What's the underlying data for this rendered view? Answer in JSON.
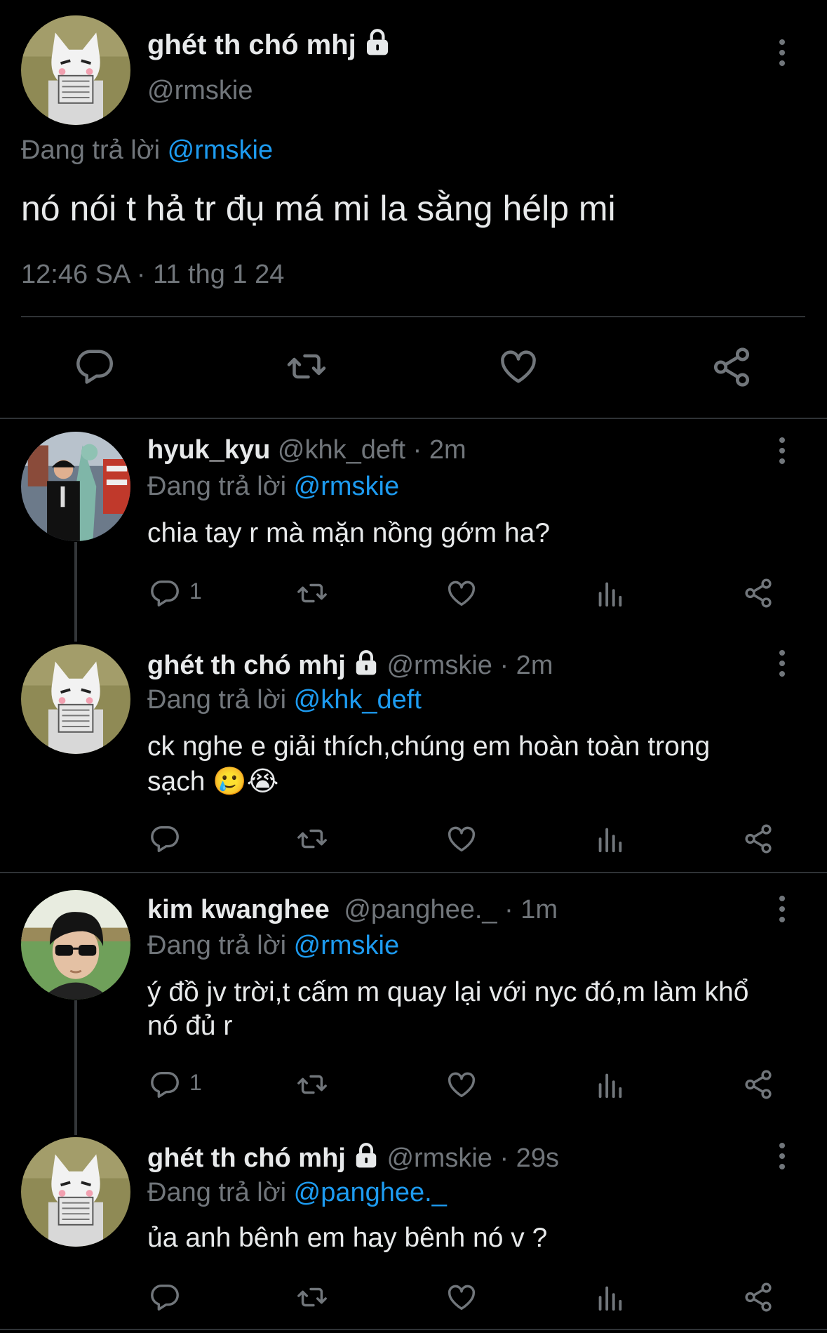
{
  "main_tweet": {
    "display_name": "ghét th chó mhj",
    "handle": "@rmskie",
    "replying_prefix": "Đang trả lời",
    "replying_to": "@rmskie",
    "text": "nó nói t hả tr đụ má mi la sằng hélp mi",
    "timestamp": "12:46 SA · 11 thg 1 24"
  },
  "replies": [
    {
      "display_name": "hyuk_kyu",
      "handle": "@khk_deft",
      "time": "· 2m",
      "replying_prefix": "Đang trả lời",
      "replying_to": "@rmskie",
      "text": "chia tay r mà mặn nồng gớm ha?",
      "reply_count": "1"
    },
    {
      "display_name": "ghét th chó mhj",
      "handle": "@rmskie",
      "time": "· 2m",
      "replying_prefix": "Đang trả lời",
      "replying_to": "@khk_deft",
      "text_line1": "ck nghe e giải thích,chúng em hoàn toàn trong",
      "text_line2": "sạch 🥲😭",
      "reply_count": ""
    },
    {
      "display_name": "kim kwanghee",
      "handle": "@panghee._",
      "time": "· 1m",
      "replying_prefix": "Đang trả lời",
      "replying_to": "@rmskie",
      "text_line1": "ý đồ jv trời,t cấm m quay lại với nyc đó,m làm khổ",
      "text_line2": "nó đủ r",
      "reply_count": "1"
    },
    {
      "display_name": "ghét th chó mhj",
      "handle": "@rmskie",
      "time": "· 29s",
      "replying_prefix": "Đang trả lời",
      "replying_to": "@panghee._",
      "text": "ủa anh bênh em hay bênh nó v ?",
      "reply_count": ""
    }
  ],
  "icons": [
    "reply-icon",
    "retweet-icon",
    "like-icon",
    "views-icon",
    "share-icon",
    "lock-icon",
    "more-icon"
  ],
  "colors": {
    "background": "#000000",
    "text": "#e7e9ea",
    "muted": "#71767b",
    "link": "#1d9bf0",
    "divider": "#2f3336"
  }
}
